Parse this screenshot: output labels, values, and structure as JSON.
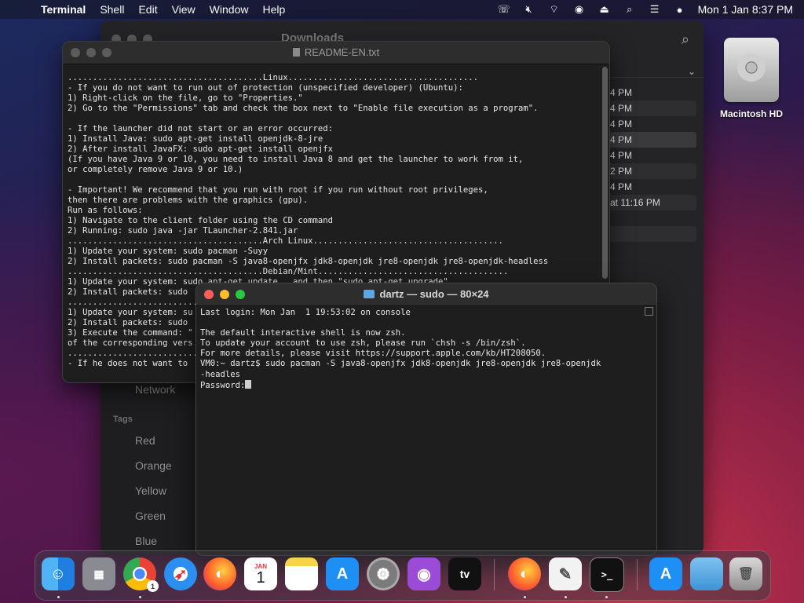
{
  "menubar": {
    "app_name": "Terminal",
    "items": [
      "Shell",
      "Edit",
      "View",
      "Window",
      "Help"
    ],
    "clock": "Mon 1 Jan  8:37 PM"
  },
  "finder": {
    "title": "Downloads",
    "sidebar": {
      "network": "Network",
      "tags_header": "Tags",
      "tags": [
        "Red",
        "Orange",
        "Yellow",
        "Green",
        "Blue"
      ]
    },
    "rows": [
      "4 PM",
      "4 PM",
      "4 PM",
      "4 PM",
      "4 PM",
      "2 PM",
      "4 PM",
      "at 11:16 PM"
    ]
  },
  "readme": {
    "title": "README-EN.txt",
    "lines": [
      ".......................................Linux......................................",
      "- If you do not want to run out of protection (unspecified developer) (Ubuntu):",
      "1) Right-click on the file, go to \"Properties.\"",
      "2) Go to the \"Permissions\" tab and check the box next to \"Enable file execution as a program\".",
      "",
      "- If the launcher did not start or an error occurred:",
      "1) Install Java: sudo apt-get install openjdk-8-jre",
      "2) After install JavaFX: sudo apt-get install openjfx",
      "(If you have Java 9 or 10, you need to install Java 8 and get the launcher to work from it,",
      "or completely remove Java 9 or 10.)",
      "",
      "- Important! We recommend that you run with root if you run without root privileges,",
      "then there are problems with the graphics (gpu).",
      "Run as follows:",
      "1) Navigate to the client folder using the CD command",
      "2) Running: sudo java -jar TLauncher-2.841.jar",
      ".......................................Arch Linux......................................",
      "1) Update your system: sudo pacman -Suyy",
      "2) Install packets: sudo pacman -S java8-openjfx jdk8-openjdk jre8-openjdk jre8-openjdk-headless",
      ".......................................Debian/Mint......................................",
      "1) Update your system: sudo apt-get update , and then \"sudo apt-get upgrade\"",
      "2) Install packets: sudo",
      ".............................",
      "1) Update your system: su",
      "2) Install packets: sudo",
      "3) Execute the command: \"",
      "of the corresponding vers",
      ".............................",
      "- If he does not want to"
    ]
  },
  "terminal": {
    "title": "dartz — sudo — 80×24",
    "lines": [
      "Last login: Mon Jan  1 19:53:02 on console",
      "",
      "The default interactive shell is now zsh.",
      "To update your account to use zsh, please run `chsh -s /bin/zsh`.",
      "For more details, please visit https://support.apple.com/kb/HT208050.",
      "VM0:~ dartz$ sudo pacman -S java8-openjfx jdk8-openjdk jre8-openjdk jre8-openjdk",
      "-headles"
    ],
    "prompt": "Password:"
  },
  "desktop": {
    "drive_label": "Macintosh HD"
  },
  "dock": {
    "calendar_month": "JAN",
    "calendar_day": "1",
    "chrome_badge": "1",
    "tv_label": "tv"
  },
  "colors": {
    "accent_red": "#ff5f57",
    "accent_yellow": "#febc2e",
    "accent_green": "#28c840",
    "folder_blue": "#5aa9e6"
  }
}
